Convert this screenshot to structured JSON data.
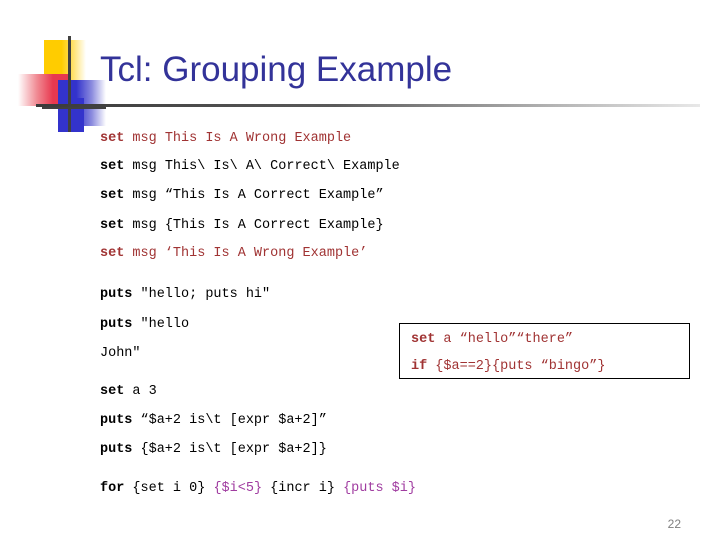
{
  "slide": {
    "title": "Tcl: Grouping Example",
    "number": "22",
    "colors": {
      "title": "#333399",
      "wrong_example": "#A03333",
      "highlight": "#A03CA0",
      "body": "#000000"
    }
  },
  "code_lines": [
    {
      "id": "line-set-wrong-bare",
      "color": "wrong",
      "keyword": "set",
      "rest": " msg This Is A Wrong Example"
    },
    {
      "id": "line-set-correct-escaped",
      "color": "body",
      "keyword": "set",
      "rest": " msg This\\ Is\\ A\\ Correct\\ Example"
    },
    {
      "id": "line-set-correct-dquote",
      "color": "body",
      "keyword": "set",
      "rest": " msg “This Is A Correct Example”"
    },
    {
      "id": "line-set-correct-brace",
      "color": "body",
      "keyword": "set",
      "rest": " msg {This Is A Correct Example}"
    },
    {
      "id": "line-set-wrong-squote",
      "color": "wrong",
      "keyword": "set",
      "rest": " msg ‘This Is A Wrong Example’"
    },
    {
      "id": "line-puts-semicolon",
      "color": "body",
      "keyword": "puts",
      "rest": " \"hello; puts hi\""
    },
    {
      "id": "line-puts-multiline-open",
      "color": "body",
      "keyword": "puts",
      "rest": " \"hello"
    },
    {
      "id": "line-puts-multiline-close",
      "color": "body",
      "keyword": "",
      "rest": "John\""
    },
    {
      "id": "line-set-a-3",
      "color": "body",
      "keyword": "set",
      "rest": " a 3"
    },
    {
      "id": "line-puts-expr-dquote",
      "color": "body",
      "keyword": "puts",
      "rest": " “$a+2 is\\t [expr $a+2]”"
    },
    {
      "id": "line-puts-expr-brace",
      "color": "body",
      "keyword": "puts",
      "rest": " {$a+2 is\\t [expr $a+2]}"
    }
  ],
  "for_line": {
    "id": "line-for-loop",
    "keyword": "for",
    "seg_init": " {set i 0} ",
    "seg_cond": "{$i<5}",
    "seg_incr": " {incr i} ",
    "seg_body": "{puts $i}"
  },
  "callout": {
    "line1": {
      "keyword": "set",
      "rest": " a “hello”“there”"
    },
    "line2": {
      "keyword": "if",
      "rest": " {$a==2}{puts “bingo”}"
    }
  }
}
